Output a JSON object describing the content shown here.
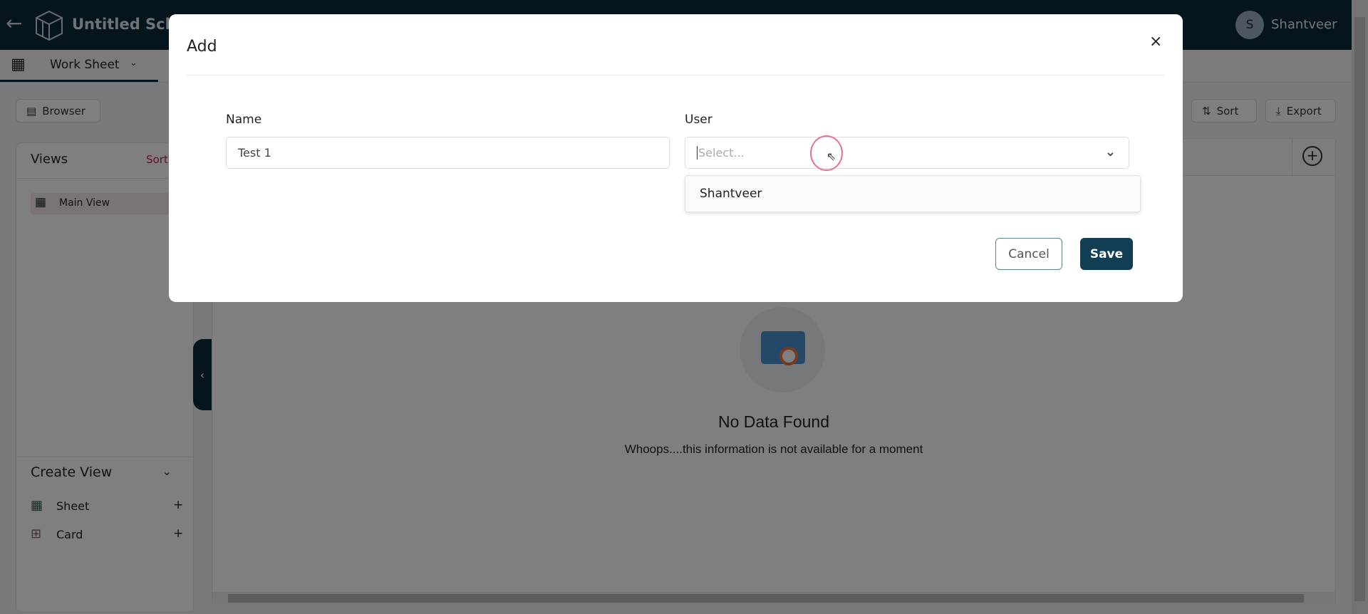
{
  "header": {
    "title": "Untitled Sche",
    "user_initial": "S",
    "user_name": "Shantveer"
  },
  "tabbar": {
    "tab_label": "Work Sheet"
  },
  "toolbar": {
    "browser_label": "Browser",
    "sort_label": "Sort",
    "export_label": "Export"
  },
  "sidebar": {
    "views_title": "Views",
    "sort_label": "Sort",
    "views": [
      {
        "label": "Main View"
      }
    ],
    "create_view_title": "Create View",
    "create_items": [
      {
        "label": "Sheet",
        "icon": "grid-icon"
      },
      {
        "label": "Card",
        "icon": "card-grid-icon"
      }
    ]
  },
  "empty_state": {
    "title": "No Data Found",
    "message": "Whoops....this information is not available for a moment"
  },
  "modal": {
    "title": "Add",
    "name_label": "Name",
    "name_value": "Test 1",
    "user_label": "User",
    "user_placeholder": "Select...",
    "user_options": [
      "Shantveer"
    ],
    "cancel_label": "Cancel",
    "save_label": "Save"
  },
  "colors": {
    "header": "#0b2a3d",
    "primary": "#123e55",
    "sort_accent": "#c2185b",
    "cursor_ring": "#e57390"
  }
}
